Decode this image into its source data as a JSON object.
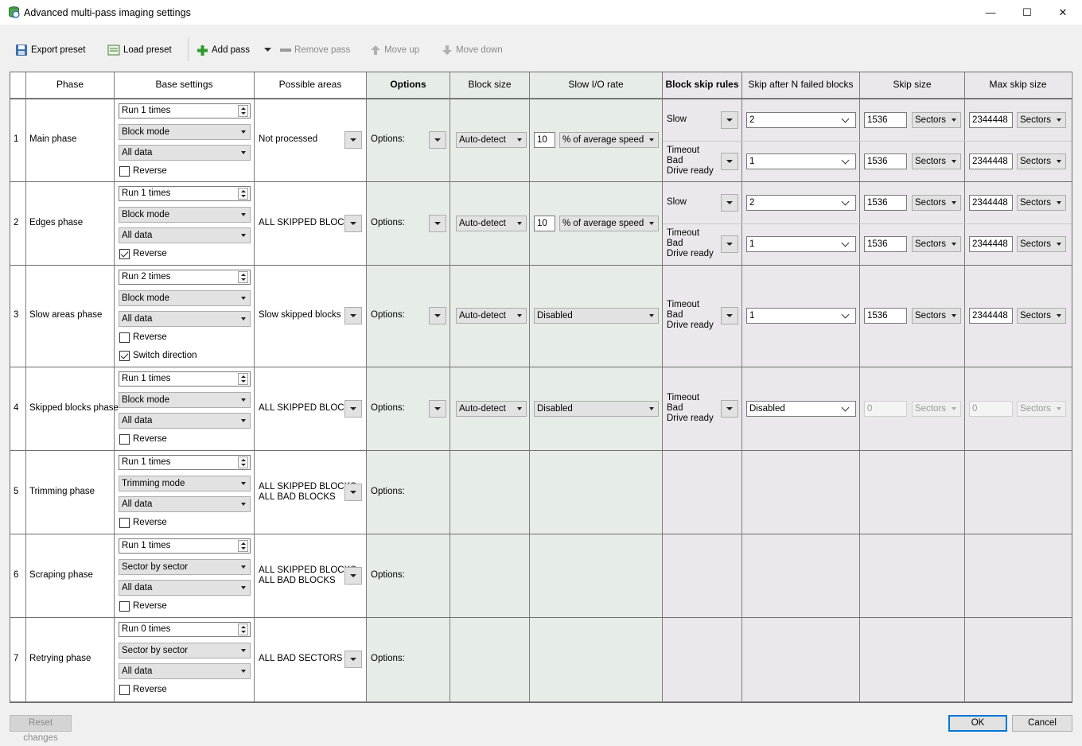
{
  "window": {
    "title": "Advanced multi-pass imaging settings",
    "minimize": "—",
    "maximize": "☐",
    "close": "✕"
  },
  "toolbar": {
    "export_preset": "Export preset",
    "load_preset": "Load preset",
    "add_pass": "Add pass",
    "remove_pass": "Remove pass",
    "move_up": "Move up",
    "move_down": "Move down"
  },
  "columns": [
    "Phase",
    "Base settings",
    "Possible areas",
    "Options",
    "Block size",
    "Slow I/O rate",
    "Block skip rules",
    "Skip after N failed blocks",
    "Skip size",
    "Max skip size"
  ],
  "options_label": "Options:",
  "reverse_label": "Reverse",
  "switch_direction_label": "Switch direction",
  "colors": {
    "options_bg": "#e6ede6",
    "skip_bg": "#ebe7ec",
    "accent": "#0078d7"
  },
  "rows": [
    {
      "num": "1",
      "phase": "Main phase",
      "run": "Run 1 times",
      "mode": "Block mode",
      "data": "All data",
      "reverse": false,
      "areas": [
        "Not processed"
      ],
      "block_size": "Auto-detect",
      "slow_value": "10",
      "slow_mode": "% of average speed",
      "rules": [
        {
          "label": [
            "Slow"
          ],
          "after": "2",
          "skip": "1536",
          "skip_unit": "Sectors",
          "max": "2344448",
          "max_unit": "Sectors"
        },
        {
          "label": [
            "Timeout",
            "Bad",
            "Drive ready"
          ],
          "after": "1",
          "skip": "1536",
          "skip_unit": "Sectors",
          "max": "2344448",
          "max_unit": "Sectors"
        }
      ]
    },
    {
      "num": "2",
      "phase": "Edges phase",
      "run": "Run 1 times",
      "mode": "Block mode",
      "data": "All data",
      "reverse": true,
      "areas": [
        "ALL SKIPPED BLOCKS"
      ],
      "block_size": "Auto-detect",
      "slow_value": "10",
      "slow_mode": "% of average speed",
      "rules": [
        {
          "label": [
            "Slow"
          ],
          "after": "2",
          "skip": "1536",
          "skip_unit": "Sectors",
          "max": "2344448",
          "max_unit": "Sectors"
        },
        {
          "label": [
            "Timeout",
            "Bad",
            "Drive ready"
          ],
          "after": "1",
          "skip": "1536",
          "skip_unit": "Sectors",
          "max": "2344448",
          "max_unit": "Sectors"
        }
      ]
    },
    {
      "num": "3",
      "phase": "Slow areas phase",
      "run": "Run 2 times",
      "mode": "Block mode",
      "data": "All data",
      "reverse": false,
      "switch": true,
      "areas": [
        "Slow skipped blocks"
      ],
      "block_size": "Auto-detect",
      "slow_mode": "Disabled",
      "rules": [
        {
          "label": [
            "Timeout",
            "Bad",
            "Drive ready"
          ],
          "after": "1",
          "skip": "1536",
          "skip_unit": "Sectors",
          "max": "2344448",
          "max_unit": "Sectors"
        }
      ]
    },
    {
      "num": "4",
      "phase": "Skipped blocks phase",
      "run": "Run 1 times",
      "mode": "Block mode",
      "data": "All data",
      "reverse": false,
      "areas": [
        "ALL SKIPPED BLOCKS"
      ],
      "block_size": "Auto-detect",
      "slow_mode": "Disabled",
      "rules": [
        {
          "label": [
            "Timeout",
            "Bad",
            "Drive ready"
          ],
          "after": "Disabled",
          "skip": "0",
          "skip_unit": "Sectors",
          "max": "0",
          "max_unit": "Sectors",
          "disabled": true
        }
      ]
    },
    {
      "num": "5",
      "phase": "Trimming phase",
      "run": "Run 1 times",
      "mode": "Trimming mode",
      "data": "All data",
      "reverse": false,
      "areas": [
        "ALL SKIPPED BLOCKS",
        "ALL BAD BLOCKS"
      ],
      "rules": []
    },
    {
      "num": "6",
      "phase": "Scraping phase",
      "run": "Run 1 times",
      "mode": "Sector by sector",
      "data": "All data",
      "reverse": false,
      "areas": [
        "ALL SKIPPED BLOCKS",
        "ALL BAD BLOCKS"
      ],
      "rules": []
    },
    {
      "num": "7",
      "phase": "Retrying phase",
      "run": "Run 0 times",
      "mode": "Sector by sector",
      "data": "All data",
      "reverse": false,
      "areas": [
        "ALL BAD SECTORS"
      ],
      "rules": []
    }
  ],
  "footer": {
    "reset": "Reset changes",
    "ok": "OK",
    "cancel": "Cancel"
  }
}
